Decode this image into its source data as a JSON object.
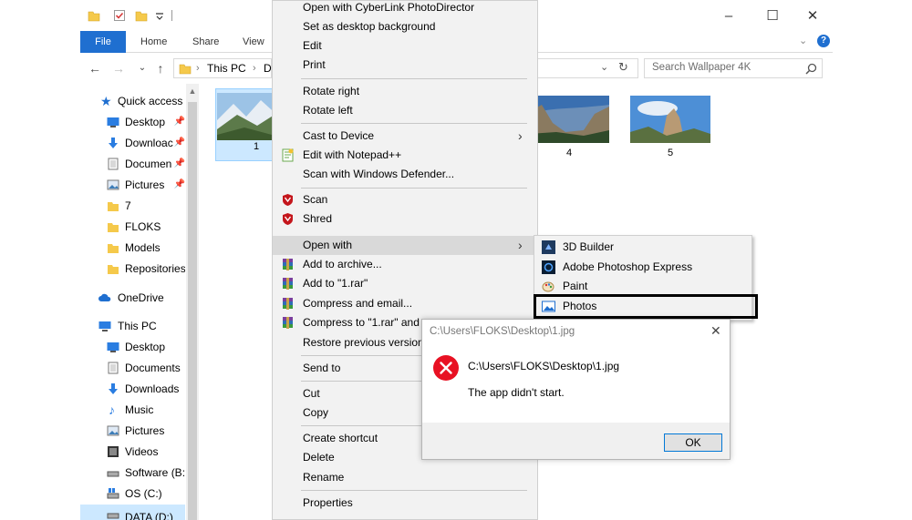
{
  "colors": {
    "accent": "#1f6fd0",
    "menu_bg": "#f2f2f2",
    "highlight": "#d9d9d9",
    "selection": "#cce8ff",
    "error_red": "#e81123"
  },
  "explorer": {
    "ribbon_tabs": [
      "File",
      "Home",
      "Share",
      "View"
    ],
    "address": {
      "this_pc": "This PC",
      "truncated": "D"
    },
    "search_placeholder": "Search Wallpaper 4K",
    "window_controls": [
      "minimize-icon",
      "maximize-icon",
      "close-icon"
    ]
  },
  "navpane": {
    "quick_access": "Quick access",
    "items": [
      {
        "label": "Desktop",
        "icon": "desktop-icon",
        "pinned": true
      },
      {
        "label": "Downloac",
        "icon": "download-icon",
        "pinned": true
      },
      {
        "label": "Documen",
        "icon": "document-icon",
        "pinned": true
      },
      {
        "label": "Pictures",
        "icon": "pictures-icon",
        "pinned": true
      },
      {
        "label": "7",
        "icon": "folder-icon",
        "pinned": false
      },
      {
        "label": "FLOKS",
        "icon": "folder-icon",
        "pinned": false
      },
      {
        "label": "Models",
        "icon": "folder-icon",
        "pinned": false
      },
      {
        "label": "Repositories",
        "icon": "folder-icon",
        "pinned": false
      }
    ],
    "onedrive": "OneDrive",
    "this_pc": "This PC",
    "pc_items": [
      {
        "label": "Desktop",
        "icon": "desktop-icon"
      },
      {
        "label": "Documents",
        "icon": "document-icon"
      },
      {
        "label": "Downloads",
        "icon": "download-icon"
      },
      {
        "label": "Music",
        "icon": "music-icon"
      },
      {
        "label": "Pictures",
        "icon": "pictures-icon"
      },
      {
        "label": "Videos",
        "icon": "video-icon"
      },
      {
        "label": "Software (B:)",
        "icon": "drive-icon"
      },
      {
        "label": "OS (C:)",
        "icon": "windows-drive-icon"
      },
      {
        "label": "DATA (D:)",
        "icon": "drive-icon"
      }
    ]
  },
  "files": [
    {
      "label": "1",
      "selected": true
    },
    {
      "label": "4",
      "selected": false
    },
    {
      "label": "5",
      "selected": false
    }
  ],
  "context_menu": {
    "items": [
      {
        "label": "Open with CyberLink PhotoDirector"
      },
      {
        "label": "Set as desktop background"
      },
      {
        "label": "Edit"
      },
      {
        "label": "Print"
      },
      {
        "label": "Rotate right"
      },
      {
        "label": "Rotate left"
      },
      {
        "label": "Cast to Device"
      },
      {
        "label": "Edit with Notepad++"
      },
      {
        "label": "Scan with Windows Defender..."
      },
      {
        "label": "Scan"
      },
      {
        "label": "Shred"
      },
      {
        "label": "Open with"
      },
      {
        "label": "Add to archive..."
      },
      {
        "label": "Add to \"1.rar\""
      },
      {
        "label": "Compress and email..."
      },
      {
        "label": "Compress to \"1.rar\" and e"
      },
      {
        "label": "Restore previous versions"
      },
      {
        "label": "Send to"
      },
      {
        "label": "Cut"
      },
      {
        "label": "Copy"
      },
      {
        "label": "Create shortcut"
      },
      {
        "label": "Delete"
      },
      {
        "label": "Rename"
      },
      {
        "label": "Properties"
      }
    ]
  },
  "submenu": {
    "items": [
      {
        "label": "3D Builder",
        "icon": "3d-builder-icon"
      },
      {
        "label": "Adobe Photoshop Express",
        "icon": "photoshop-express-icon"
      },
      {
        "label": "Paint",
        "icon": "paint-icon"
      },
      {
        "label": "Photos",
        "icon": "photos-icon"
      }
    ]
  },
  "dialog": {
    "title": "C:\\Users\\FLOKS\\Desktop\\1.jpg",
    "path": "C:\\Users\\FLOKS\\Desktop\\1.jpg",
    "message": "The app didn't start.",
    "ok_label": "OK"
  }
}
